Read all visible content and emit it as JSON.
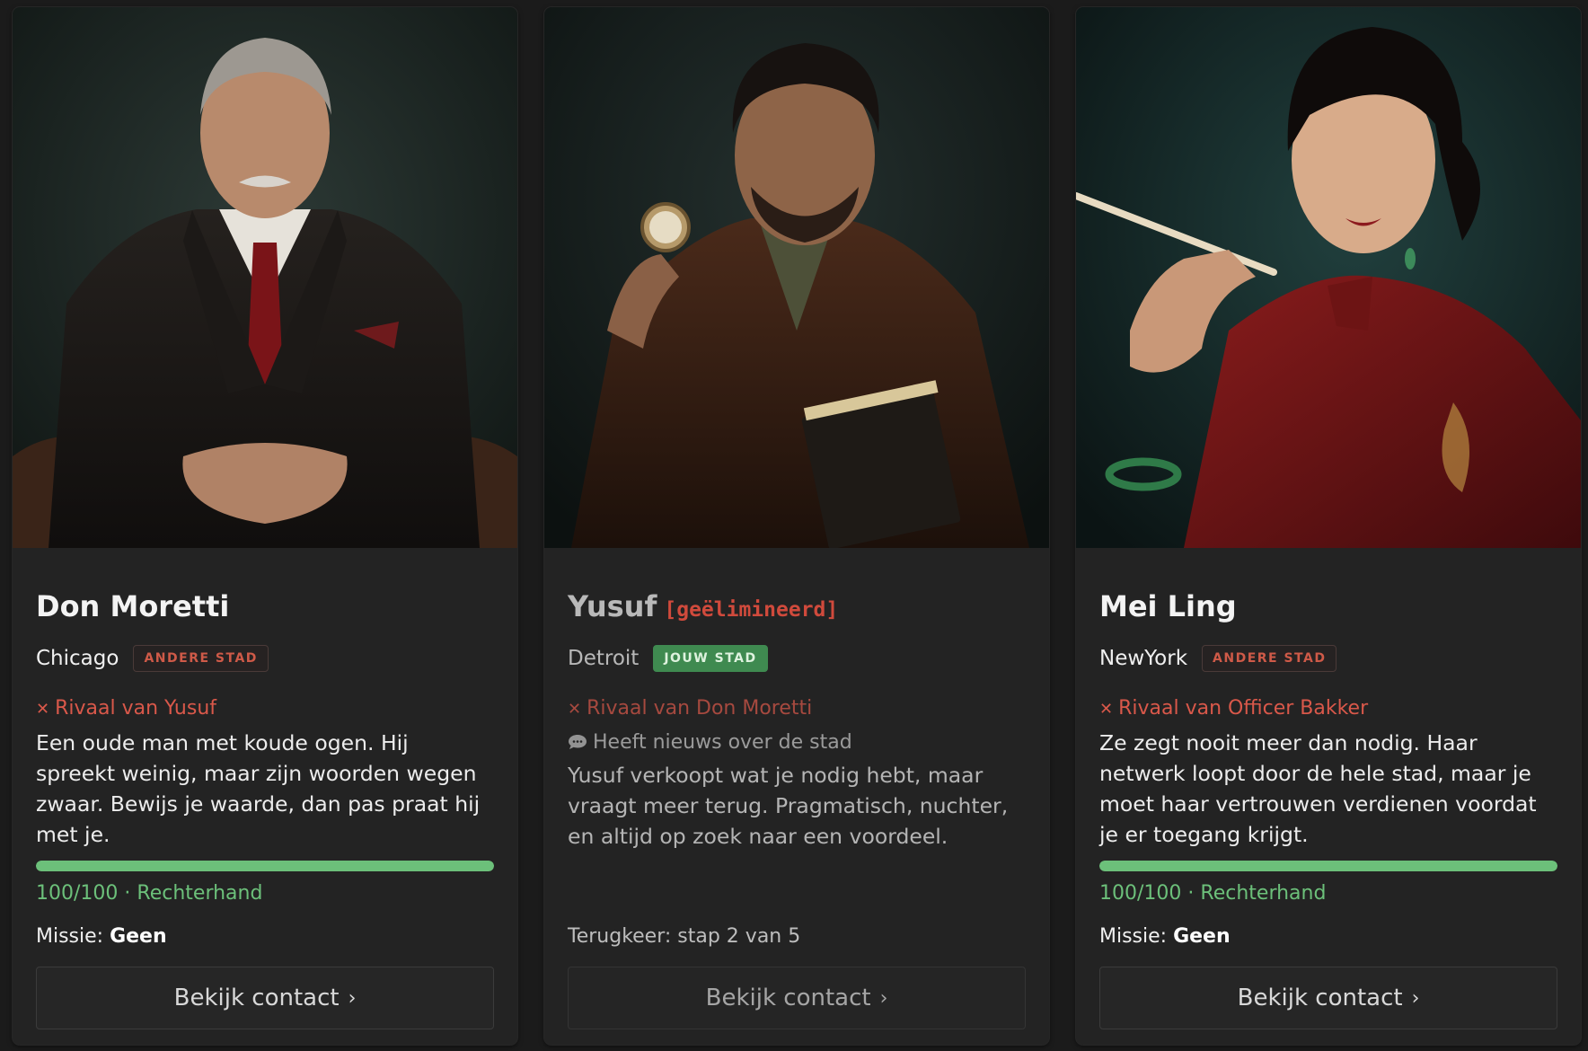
{
  "cards": [
    {
      "name": "Don Moretti",
      "city": "Chicago",
      "city_badge": "ANDERE STAD",
      "rival": "Rivaal van Yusuf",
      "description": "Een oude man met koude ogen. Hij spreekt weinig, maar zijn woorden wegen zwaar. Bewijs je waarde, dan pas praat hij met je.",
      "relation_score": "100/100",
      "relation_fraction": 1.0,
      "relation_separator": "·",
      "relation_label": "Rechterhand",
      "mission_label": "Missie:",
      "mission_value": "Geen",
      "button_label": "Bekijk contact",
      "button_icon": "chevron-right-icon"
    },
    {
      "name": "Yusuf",
      "status_tag": "[geëlimineerd]",
      "city": "Detroit",
      "city_badge": "JOUW STAD",
      "rival": "Rivaal van Don Moretti",
      "news": "Heeft nieuws over de stad",
      "news_icon": "speech-bubble-icon",
      "description": "Yusuf verkoopt wat je nodig hebt, maar vraagt meer terug. Pragmatisch, nuchter, en altijd op zoek naar een voordeel.",
      "return_step": "Terugkeer: stap 2 van 5",
      "button_label": "Bekijk contact",
      "button_icon": "chevron-right-icon"
    },
    {
      "name": "Mei Ling",
      "city": "NewYork",
      "city_badge": "ANDERE STAD",
      "rival": "Rivaal van Officer Bakker",
      "description": "Ze zegt nooit meer dan nodig. Haar netwerk loopt door de hele stad, maar je moet haar vertrouwen verdienen voordat je er toegang krijgt.",
      "relation_score": "100/100",
      "relation_fraction": 1.0,
      "relation_separator": "·",
      "relation_label": "Rechterhand",
      "mission_label": "Missie:",
      "mission_value": "Geen",
      "button_label": "Bekijk contact",
      "button_icon": "chevron-right-icon"
    }
  ],
  "colors": {
    "rival": "#d9584a",
    "relation_bar": "#6cc07a",
    "own_city_badge": "#3f8a50",
    "eliminated": "#d04a3c"
  }
}
